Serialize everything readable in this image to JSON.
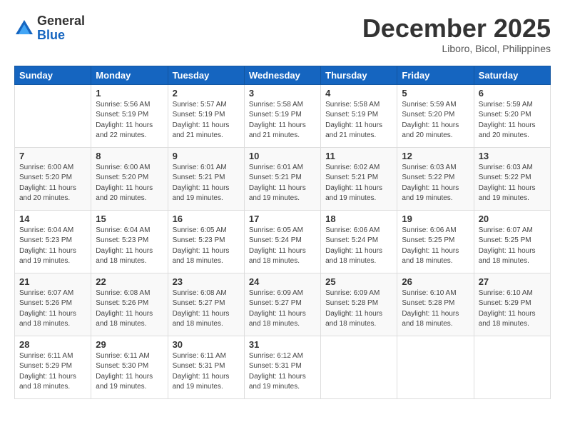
{
  "logo": {
    "general": "General",
    "blue": "Blue"
  },
  "header": {
    "month": "December 2025",
    "location": "Liboro, Bicol, Philippines"
  },
  "weekdays": [
    "Sunday",
    "Monday",
    "Tuesday",
    "Wednesday",
    "Thursday",
    "Friday",
    "Saturday"
  ],
  "weeks": [
    [
      {
        "day": "",
        "sunrise": "",
        "sunset": "",
        "daylight": ""
      },
      {
        "day": "1",
        "sunrise": "Sunrise: 5:56 AM",
        "sunset": "Sunset: 5:19 PM",
        "daylight": "Daylight: 11 hours and 22 minutes."
      },
      {
        "day": "2",
        "sunrise": "Sunrise: 5:57 AM",
        "sunset": "Sunset: 5:19 PM",
        "daylight": "Daylight: 11 hours and 21 minutes."
      },
      {
        "day": "3",
        "sunrise": "Sunrise: 5:58 AM",
        "sunset": "Sunset: 5:19 PM",
        "daylight": "Daylight: 11 hours and 21 minutes."
      },
      {
        "day": "4",
        "sunrise": "Sunrise: 5:58 AM",
        "sunset": "Sunset: 5:19 PM",
        "daylight": "Daylight: 11 hours and 21 minutes."
      },
      {
        "day": "5",
        "sunrise": "Sunrise: 5:59 AM",
        "sunset": "Sunset: 5:20 PM",
        "daylight": "Daylight: 11 hours and 20 minutes."
      },
      {
        "day": "6",
        "sunrise": "Sunrise: 5:59 AM",
        "sunset": "Sunset: 5:20 PM",
        "daylight": "Daylight: 11 hours and 20 minutes."
      }
    ],
    [
      {
        "day": "7",
        "sunrise": "Sunrise: 6:00 AM",
        "sunset": "Sunset: 5:20 PM",
        "daylight": "Daylight: 11 hours and 20 minutes."
      },
      {
        "day": "8",
        "sunrise": "Sunrise: 6:00 AM",
        "sunset": "Sunset: 5:20 PM",
        "daylight": "Daylight: 11 hours and 20 minutes."
      },
      {
        "day": "9",
        "sunrise": "Sunrise: 6:01 AM",
        "sunset": "Sunset: 5:21 PM",
        "daylight": "Daylight: 11 hours and 19 minutes."
      },
      {
        "day": "10",
        "sunrise": "Sunrise: 6:01 AM",
        "sunset": "Sunset: 5:21 PM",
        "daylight": "Daylight: 11 hours and 19 minutes."
      },
      {
        "day": "11",
        "sunrise": "Sunrise: 6:02 AM",
        "sunset": "Sunset: 5:21 PM",
        "daylight": "Daylight: 11 hours and 19 minutes."
      },
      {
        "day": "12",
        "sunrise": "Sunrise: 6:03 AM",
        "sunset": "Sunset: 5:22 PM",
        "daylight": "Daylight: 11 hours and 19 minutes."
      },
      {
        "day": "13",
        "sunrise": "Sunrise: 6:03 AM",
        "sunset": "Sunset: 5:22 PM",
        "daylight": "Daylight: 11 hours and 19 minutes."
      }
    ],
    [
      {
        "day": "14",
        "sunrise": "Sunrise: 6:04 AM",
        "sunset": "Sunset: 5:23 PM",
        "daylight": "Daylight: 11 hours and 19 minutes."
      },
      {
        "day": "15",
        "sunrise": "Sunrise: 6:04 AM",
        "sunset": "Sunset: 5:23 PM",
        "daylight": "Daylight: 11 hours and 18 minutes."
      },
      {
        "day": "16",
        "sunrise": "Sunrise: 6:05 AM",
        "sunset": "Sunset: 5:23 PM",
        "daylight": "Daylight: 11 hours and 18 minutes."
      },
      {
        "day": "17",
        "sunrise": "Sunrise: 6:05 AM",
        "sunset": "Sunset: 5:24 PM",
        "daylight": "Daylight: 11 hours and 18 minutes."
      },
      {
        "day": "18",
        "sunrise": "Sunrise: 6:06 AM",
        "sunset": "Sunset: 5:24 PM",
        "daylight": "Daylight: 11 hours and 18 minutes."
      },
      {
        "day": "19",
        "sunrise": "Sunrise: 6:06 AM",
        "sunset": "Sunset: 5:25 PM",
        "daylight": "Daylight: 11 hours and 18 minutes."
      },
      {
        "day": "20",
        "sunrise": "Sunrise: 6:07 AM",
        "sunset": "Sunset: 5:25 PM",
        "daylight": "Daylight: 11 hours and 18 minutes."
      }
    ],
    [
      {
        "day": "21",
        "sunrise": "Sunrise: 6:07 AM",
        "sunset": "Sunset: 5:26 PM",
        "daylight": "Daylight: 11 hours and 18 minutes."
      },
      {
        "day": "22",
        "sunrise": "Sunrise: 6:08 AM",
        "sunset": "Sunset: 5:26 PM",
        "daylight": "Daylight: 11 hours and 18 minutes."
      },
      {
        "day": "23",
        "sunrise": "Sunrise: 6:08 AM",
        "sunset": "Sunset: 5:27 PM",
        "daylight": "Daylight: 11 hours and 18 minutes."
      },
      {
        "day": "24",
        "sunrise": "Sunrise: 6:09 AM",
        "sunset": "Sunset: 5:27 PM",
        "daylight": "Daylight: 11 hours and 18 minutes."
      },
      {
        "day": "25",
        "sunrise": "Sunrise: 6:09 AM",
        "sunset": "Sunset: 5:28 PM",
        "daylight": "Daylight: 11 hours and 18 minutes."
      },
      {
        "day": "26",
        "sunrise": "Sunrise: 6:10 AM",
        "sunset": "Sunset: 5:28 PM",
        "daylight": "Daylight: 11 hours and 18 minutes."
      },
      {
        "day": "27",
        "sunrise": "Sunrise: 6:10 AM",
        "sunset": "Sunset: 5:29 PM",
        "daylight": "Daylight: 11 hours and 18 minutes."
      }
    ],
    [
      {
        "day": "28",
        "sunrise": "Sunrise: 6:11 AM",
        "sunset": "Sunset: 5:29 PM",
        "daylight": "Daylight: 11 hours and 18 minutes."
      },
      {
        "day": "29",
        "sunrise": "Sunrise: 6:11 AM",
        "sunset": "Sunset: 5:30 PM",
        "daylight": "Daylight: 11 hours and 19 minutes."
      },
      {
        "day": "30",
        "sunrise": "Sunrise: 6:11 AM",
        "sunset": "Sunset: 5:31 PM",
        "daylight": "Daylight: 11 hours and 19 minutes."
      },
      {
        "day": "31",
        "sunrise": "Sunrise: 6:12 AM",
        "sunset": "Sunset: 5:31 PM",
        "daylight": "Daylight: 11 hours and 19 minutes."
      },
      {
        "day": "",
        "sunrise": "",
        "sunset": "",
        "daylight": ""
      },
      {
        "day": "",
        "sunrise": "",
        "sunset": "",
        "daylight": ""
      },
      {
        "day": "",
        "sunrise": "",
        "sunset": "",
        "daylight": ""
      }
    ]
  ]
}
